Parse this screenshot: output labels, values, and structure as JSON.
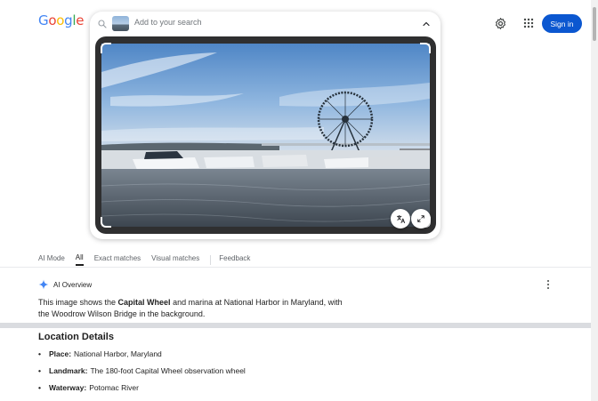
{
  "logo": {
    "letters": [
      "G",
      "o",
      "o",
      "g",
      "l",
      "e"
    ],
    "colors": [
      "#4285f4",
      "#ea4335",
      "#fbbc05",
      "#4285f4",
      "#34a853",
      "#ea4335"
    ]
  },
  "search": {
    "placeholder": "Add to your search"
  },
  "header": {
    "signin_label": "Sign in",
    "accent": "#0b57d0"
  },
  "icons": {
    "search": "magnifier-icon",
    "collapse": "chevron-up-icon",
    "settings": "gear-icon",
    "apps": "grid-apps-icon",
    "translate": "translate-icon",
    "expand": "expand-icon",
    "ai": "sparkle-icon",
    "more": "vertical-dots-icon"
  },
  "tabs": [
    {
      "label": "AI Mode"
    },
    {
      "label": "All",
      "active": true
    },
    {
      "label": "Exact matches"
    },
    {
      "label": "Visual matches"
    },
    {
      "label": "Feedback"
    }
  ],
  "ai_overview": {
    "label": "AI Overview",
    "text_before": "This image shows the ",
    "bold_subject": "Capital Wheel",
    "text_after": " and marina at National Harbor in Maryland, with the Woodrow Wilson Bridge in the background."
  },
  "location": {
    "title": "Location Details",
    "items": [
      {
        "key": "Place:",
        "value": "National Harbor, Maryland"
      },
      {
        "key": "Landmark:",
        "value": "The 180-foot Capital Wheel observation wheel"
      },
      {
        "key": "Waterway:",
        "value": "Potomac River"
      }
    ]
  }
}
